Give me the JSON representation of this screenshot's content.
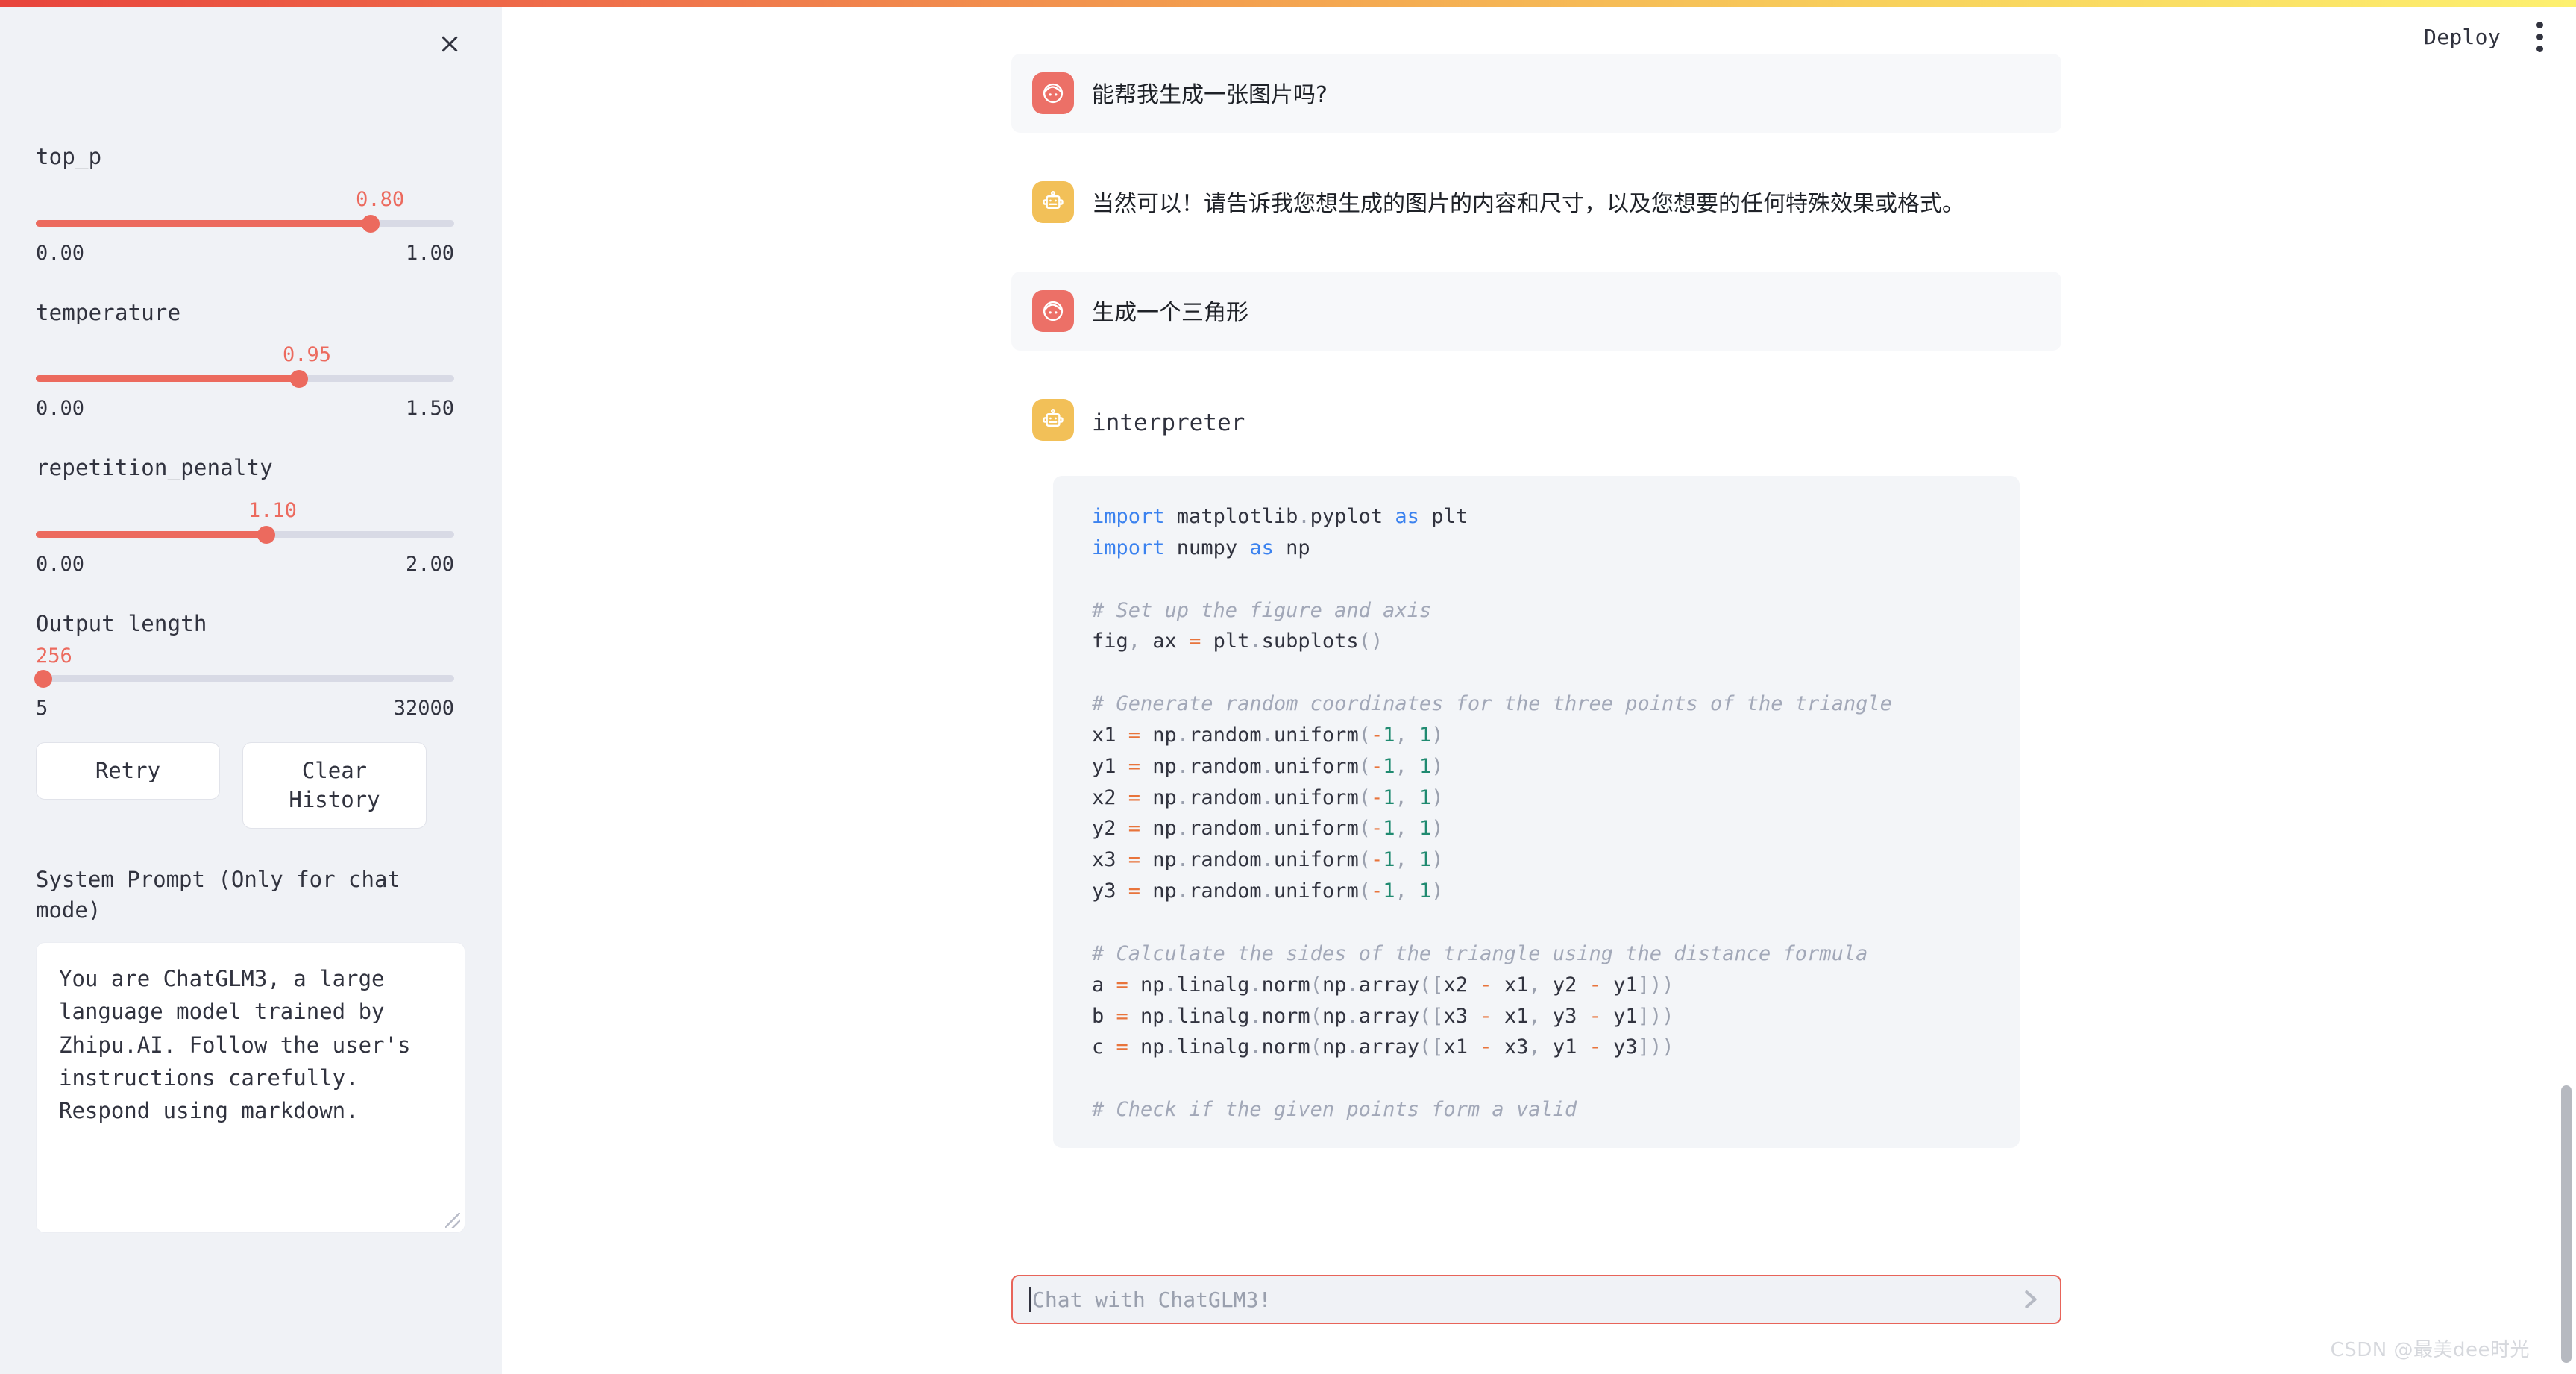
{
  "top_bar": {
    "gradient_from": "#e8443c",
    "gradient_mid": "#f3a04f",
    "gradient_to": "#fdf06f"
  },
  "header": {
    "deploy_label": "Deploy",
    "menu_icon": "kebab-menu-icon"
  },
  "sidebar": {
    "close_icon": "close-icon",
    "sliders": [
      {
        "name": "top_p",
        "label": "top_p",
        "value": "0.80",
        "min": "0.00",
        "max": "1.00",
        "fill_percent": 80,
        "accent": "#ec6a5e"
      },
      {
        "name": "temperature",
        "label": "temperature",
        "value": "0.95",
        "min": "0.00",
        "max": "1.50",
        "fill_percent": 63,
        "accent": "#ec6a5e"
      },
      {
        "name": "repetition_penalty",
        "label": "repetition_penalty",
        "value": "1.10",
        "min": "0.00",
        "max": "2.00",
        "fill_percent": 55,
        "accent": "#ec6a5e"
      },
      {
        "name": "output_length",
        "label": "Output length",
        "value": "256",
        "min": "5",
        "max": "32000",
        "fill_percent": 0.8,
        "accent": "#ec6a5e"
      }
    ],
    "buttons": {
      "retry_label": "Retry",
      "clear_history_label": "Clear History"
    },
    "system_prompt": {
      "label": "System Prompt (Only for chat mode)",
      "value": "You are ChatGLM3, a large language model trained by Zhipu.AI. Follow the user's instructions carefully. Respond using markdown."
    }
  },
  "chat": {
    "messages": [
      {
        "role": "user",
        "avatar_icon": "user-face-icon",
        "avatar_color": "#ec7067",
        "text": "能帮我生成一张图片吗?"
      },
      {
        "role": "assistant",
        "avatar_icon": "robot-icon",
        "avatar_color": "#f2c058",
        "text": "当然可以！请告诉我您想生成的图片的内容和尺寸，以及您想要的任何特殊效果或格式。"
      },
      {
        "role": "user",
        "avatar_icon": "user-face-icon",
        "avatar_color": "#ec7067",
        "text": "生成一个三角形"
      },
      {
        "role": "assistant",
        "avatar_icon": "robot-icon",
        "avatar_color": "#f2c058",
        "text": "interpreter"
      }
    ],
    "code_block": {
      "language": "python",
      "lines": [
        "import matplotlib.pyplot as plt",
        "import numpy as np",
        "",
        "# Set up the figure and axis",
        "fig, ax = plt.subplots()",
        "",
        "# Generate random coordinates for the three points of the triangle",
        "x1 = np.random.uniform(-1, 1)",
        "y1 = np.random.uniform(-1, 1)",
        "x2 = np.random.uniform(-1, 1)",
        "y2 = np.random.uniform(-1, 1)",
        "x3 = np.random.uniform(-1, 1)",
        "y3 = np.random.uniform(-1, 1)",
        "",
        "# Calculate the sides of the triangle using the distance formula",
        "a = np.linalg.norm(np.array([x2 - x1, y2 - y1]))",
        "b = np.linalg.norm(np.array([x3 - x1, y3 - y1]))",
        "c = np.linalg.norm(np.array([x1 - x3, y1 - y3]))",
        "",
        "# Check if the given points form a valid"
      ]
    },
    "input": {
      "placeholder": "Chat with ChatGLM3!",
      "value": "",
      "send_icon": "send-arrow-icon",
      "border_color": "#e8645a"
    }
  },
  "watermark": {
    "text": "CSDN @最美dee时光"
  }
}
